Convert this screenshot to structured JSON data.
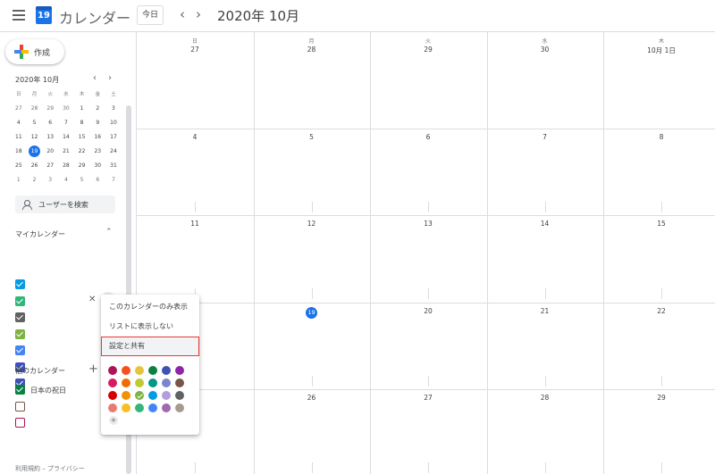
{
  "header": {
    "app_title": "カレンダー",
    "logo_day": "19",
    "today_label": "今日",
    "prev_icon": "‹",
    "next_icon": "›",
    "month_title": "2020年 10月"
  },
  "sidebar": {
    "create_label": "作成",
    "mini_calendar": {
      "title": "2020年 10月",
      "prev_icon": "‹",
      "next_icon": "›",
      "weekdays": [
        "日",
        "月",
        "火",
        "水",
        "木",
        "金",
        "土"
      ],
      "weeks": [
        [
          "27",
          "28",
          "29",
          "30",
          "1",
          "2",
          "3"
        ],
        [
          "4",
          "5",
          "6",
          "7",
          "8",
          "9",
          "10"
        ],
        [
          "11",
          "12",
          "13",
          "14",
          "15",
          "16",
          "17"
        ],
        [
          "18",
          "19",
          "20",
          "21",
          "22",
          "23",
          "24"
        ],
        [
          "25",
          "26",
          "27",
          "28",
          "29",
          "30",
          "31"
        ],
        [
          "1",
          "2",
          "3",
          "4",
          "5",
          "6",
          "7"
        ]
      ],
      "today": "19"
    },
    "people_search_label": "ユーザーを検索",
    "my_calendars_title": "マイカレンダー",
    "my_calendars": [
      {
        "color": "#039be5",
        "checked": true
      },
      {
        "color": "#33b679",
        "checked": true
      },
      {
        "color": "#616161",
        "checked": true
      },
      {
        "color": "#7cb342",
        "checked": true
      },
      {
        "color": "#4285f4",
        "checked": true
      },
      {
        "color": "#3f51b5",
        "checked": true
      },
      {
        "color": "#3f51b5",
        "checked": true
      }
    ],
    "other_calendars_title": "他のカレンダー",
    "other_calendars": [
      {
        "label": "日本の祝日",
        "color": "#0b8043",
        "checked": true
      },
      {
        "label": "",
        "color": "#795548",
        "checked": false
      },
      {
        "label": "",
        "color": "#ad1457",
        "checked": false
      }
    ],
    "footer": "利用規約 – プライバシー"
  },
  "grid": {
    "weekdays": [
      "日",
      "月",
      "火",
      "水",
      "木"
    ],
    "weeks": [
      [
        "27",
        "28",
        "29",
        "30",
        "10月 1日"
      ],
      [
        "4",
        "5",
        "6",
        "7",
        "8"
      ],
      [
        "11",
        "12",
        "13",
        "14",
        "15"
      ],
      [
        "18",
        "19",
        "20",
        "21",
        "22"
      ],
      [
        "25",
        "26",
        "27",
        "28",
        "29"
      ]
    ],
    "today": "19"
  },
  "popup": {
    "items": [
      "このカレンダーのみ表示",
      "リストに表示しない",
      "設定と共有"
    ],
    "selected_color": "#7cb342",
    "colors": [
      [
        "#ad1457",
        "#f4511e",
        "#e4c441",
        "#0b8043",
        "#3f51b5",
        "#8e24aa"
      ],
      [
        "#d81b60",
        "#ef6c00",
        "#c0ca33",
        "#009688",
        "#7986cb",
        "#795548"
      ],
      [
        "#d50000",
        "#f09300",
        "#7cb342",
        "#039be5",
        "#b39ddb",
        "#616161"
      ],
      [
        "#e67c73",
        "#f6bf26",
        "#33b679",
        "#4285f4",
        "#9e69af",
        "#a79b8e"
      ]
    ],
    "add_icon": "+"
  }
}
